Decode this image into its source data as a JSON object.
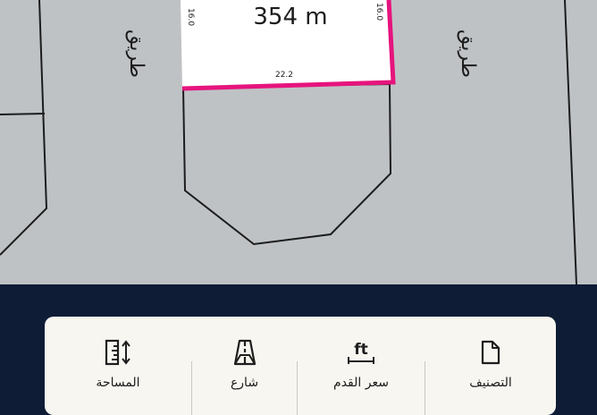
{
  "map": {
    "plot_area_text": "354 m",
    "dim_top_left": "16.0",
    "dim_top_right": "16.0",
    "dim_bottom": "22.2",
    "street_left": "طريق",
    "street_right": "طريق",
    "colors": {
      "background": "#bfc2c5",
      "plot_fill": "#ffffff",
      "plot_highlight": "#e6147d",
      "lines": "#1c1c1c"
    }
  },
  "info_bar": {
    "items": [
      {
        "icon": "area-icon",
        "label": "المساحة"
      },
      {
        "icon": "street-icon",
        "label": "شارع"
      },
      {
        "icon": "feet-icon",
        "label": "سعر القدم",
        "icon_text": "ft"
      },
      {
        "icon": "document-icon",
        "label": "التصنيف"
      }
    ]
  }
}
